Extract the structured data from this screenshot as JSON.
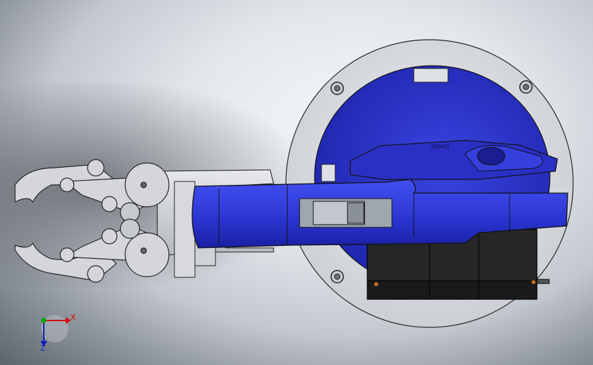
{
  "viewport": {
    "background_center": "#f4f6f9",
    "background_edge": "#5e646c"
  },
  "model": {
    "base_plate_color": "#d9dbdf",
    "base_body_color": "#2a2ec8",
    "arm_color": "#2c36d6",
    "servo_color": "#222222",
    "gripper_color": "#d3d5d9",
    "label_text": "SERVO"
  },
  "triad": {
    "x_label": "X",
    "z_label": "Z",
    "x_color": "#d01010",
    "z_color": "#1020c0",
    "origin_color": "#12a012"
  }
}
